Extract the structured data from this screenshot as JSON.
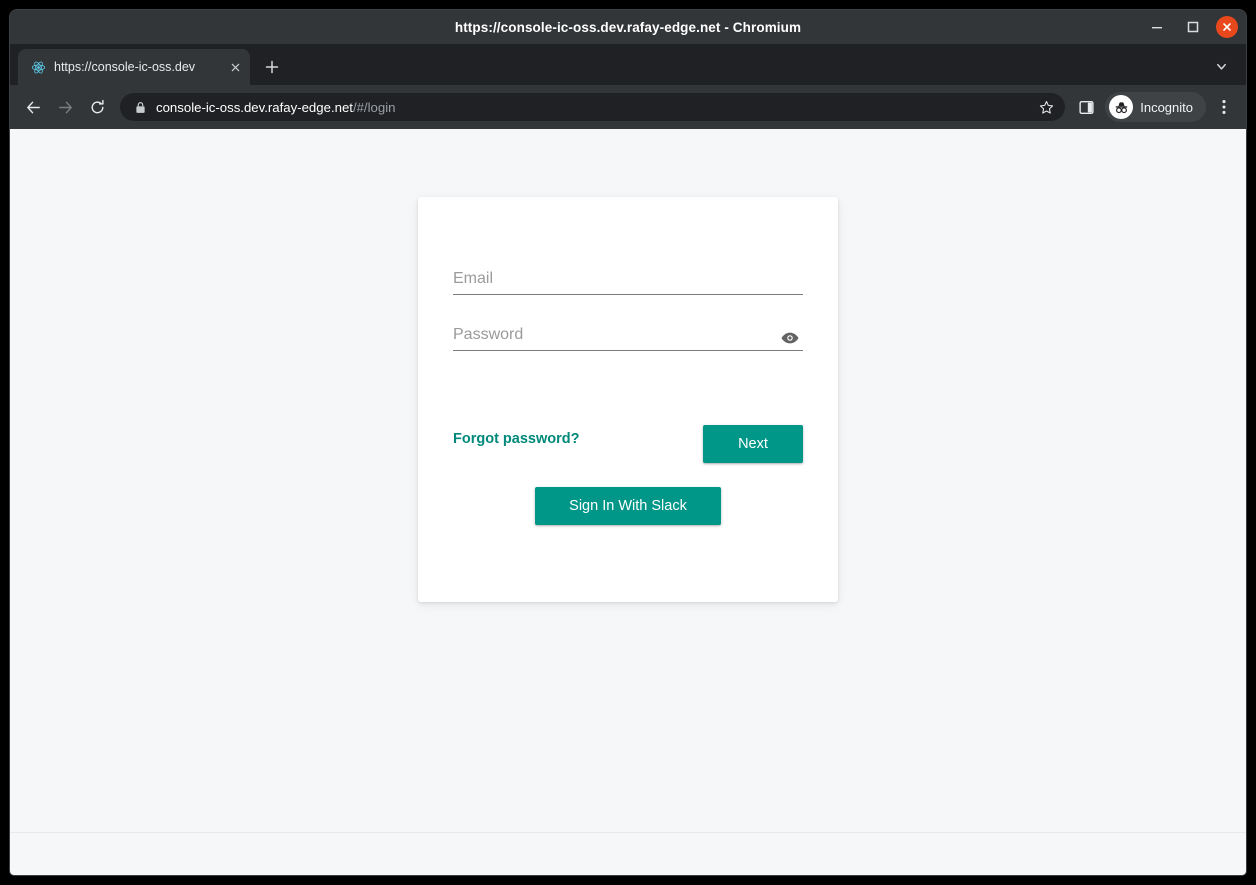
{
  "window": {
    "title": "https://console-ic-oss.dev.rafay-edge.net - Chromium",
    "controls": {
      "minimize_name": "minimize-button",
      "maximize_name": "maximize-button",
      "close_name": "close-button"
    }
  },
  "browser": {
    "tab": {
      "title": "https://console-ic-oss.dev",
      "favicon": "react-logo-icon",
      "close_label": "×"
    },
    "new_tab_label": "+",
    "tab_search_icon": "chevron-down-icon",
    "toolbar": {
      "back_icon": "back-arrow-icon",
      "forward_icon": "forward-arrow-icon",
      "reload_icon": "reload-icon",
      "lock_icon": "lock-icon",
      "url_main": "console-ic-oss.dev.rafay-edge.net",
      "url_path": "/#/login",
      "star_icon": "star-icon",
      "side_panel_icon": "side-panel-icon",
      "profile_label": "Incognito",
      "profile_icon": "incognito-hat-glasses-icon",
      "menu_icon": "three-dots-vertical-icon"
    }
  },
  "page": {
    "login": {
      "email": {
        "value": "",
        "placeholder": "Email"
      },
      "password": {
        "value": "",
        "placeholder": "Password",
        "toggle_icon": "eye-visibility-icon"
      },
      "forgot_password_label": "Forgot password?",
      "next_label": "Next",
      "slack_label": "Sign In With Slack"
    }
  },
  "colors": {
    "accent_teal": "#009688",
    "link_teal": "#00897b",
    "page_background": "#f6f7f9",
    "card_background": "#ffffff",
    "chrome_dark": "#323639",
    "tabstrip_dark": "#202124",
    "close_button_red": "#e8481c"
  }
}
